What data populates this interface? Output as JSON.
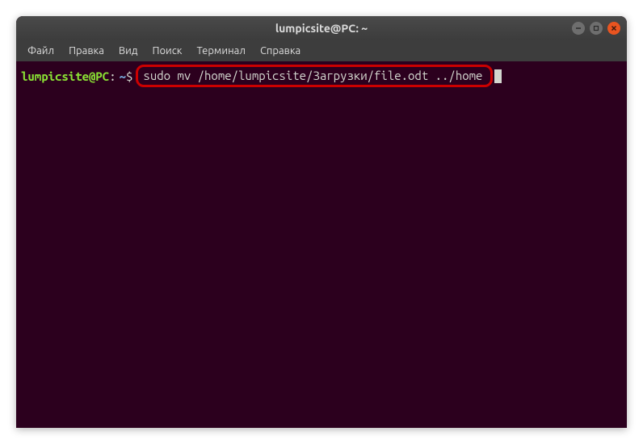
{
  "window": {
    "title": "lumpicsite@PC: ~"
  },
  "menu": {
    "file": "Файл",
    "edit": "Правка",
    "view": "Вид",
    "search": "Поиск",
    "terminal": "Терминал",
    "help": "Справка"
  },
  "terminal": {
    "prompt_user_host": "lumpicsite@PC",
    "prompt_colon": ":",
    "prompt_path": "~",
    "prompt_dollar": "$",
    "command": "sudo mv /home/lumpicsite/Загрузки/file.odt ../home"
  }
}
